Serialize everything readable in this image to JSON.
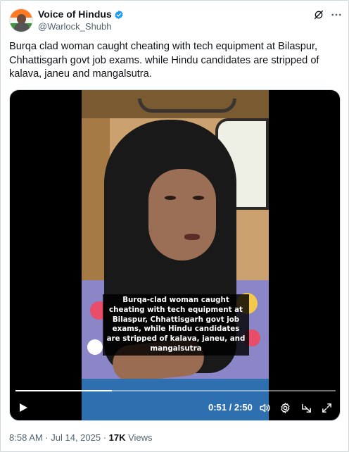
{
  "author": {
    "display_name": "Voice of Hindus",
    "handle": "@Warlock_Shubh",
    "verified_icon": "verified-badge-icon",
    "verified_color": "#1d9bf0"
  },
  "header_icons": [
    "grok-icon",
    "more-options-icon"
  ],
  "tweet": {
    "text": "Burqa clad woman caught cheating with tech equipment at Bilaspur, Chhattisgarh govt job exams. while Hindu candidates are stripped of kalava, janeu and mangalsutra."
  },
  "video": {
    "caption": "Burqa-clad woman caught cheating with tech equipment at Bilaspur, Chhattisgarh govt job exams, while Hindu candidates are stripped of kalava, janeu, and mangalsutra",
    "time_display": "0:51 / 2:50",
    "progress_fraction": 0.3,
    "controls": [
      "play-icon",
      "volume-icon",
      "settings-icon",
      "pip-icon",
      "fullscreen-icon"
    ]
  },
  "meta": {
    "timestamp": "8:58 AM · Jul 14, 2025 · ",
    "views_count": "17K",
    "views_label": " Views"
  },
  "colors": {
    "text_primary": "#0f1419",
    "text_secondary": "#536471",
    "border": "#cfd9de",
    "accent": "#1d9bf0"
  }
}
